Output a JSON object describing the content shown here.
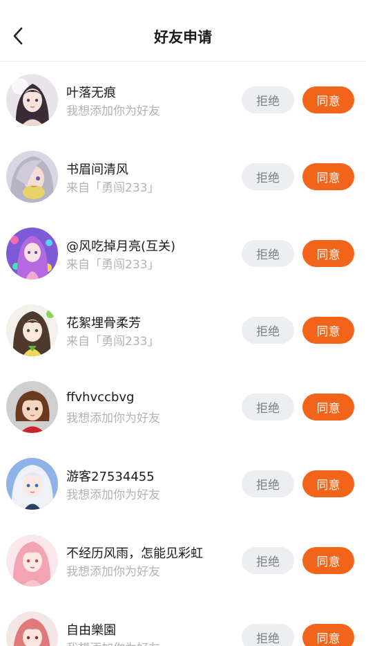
{
  "header": {
    "title": "好友申请"
  },
  "colors": {
    "accept": "#f3641b",
    "reject_bg": "#eceef1",
    "reject_text": "#7b7f86",
    "subtitle": "#b3b3b3"
  },
  "requests": [
    {
      "name": "叶落无痕",
      "message": "我想添加你为好友",
      "reject_label": "拒绝",
      "accept_label": "同意",
      "avatar": "anime-girl-dark-hair-avatar"
    },
    {
      "name": "书眉间清风",
      "message": "来自「勇闯233」",
      "reject_label": "拒绝",
      "accept_label": "同意",
      "avatar": "anime-girl-silver-hair-avatar"
    },
    {
      "name": "@风吃掉月亮(互关)",
      "message": "来自「勇闯233」",
      "reject_label": "拒绝",
      "accept_label": "同意",
      "avatar": "anime-girl-purple-hair-avatar"
    },
    {
      "name": "花絮埋骨柔芳",
      "message": "来自「勇闯233」",
      "reject_label": "拒绝",
      "accept_label": "同意",
      "avatar": "anime-girl-brown-hair-avatar"
    },
    {
      "name": "ffvhvccbvg",
      "message": "我想添加你为好友",
      "reject_label": "拒绝",
      "accept_label": "同意",
      "avatar": "cartoon-girl-short-hair-avatar"
    },
    {
      "name": "游客27534455",
      "message": "我想添加你为好友",
      "reject_label": "拒绝",
      "accept_label": "同意",
      "avatar": "anime-girl-white-hair-avatar"
    },
    {
      "name": "不经历风雨，怎能见彩虹",
      "message": "我想添加你为好友",
      "reject_label": "拒绝",
      "accept_label": "同意",
      "avatar": "anime-girl-pink-hair-avatar"
    },
    {
      "name": "自由樂園",
      "message": "我想添加你为好友",
      "reject_label": "拒绝",
      "accept_label": "同意",
      "avatar": "anime-girl-red-hair-avatar"
    }
  ]
}
